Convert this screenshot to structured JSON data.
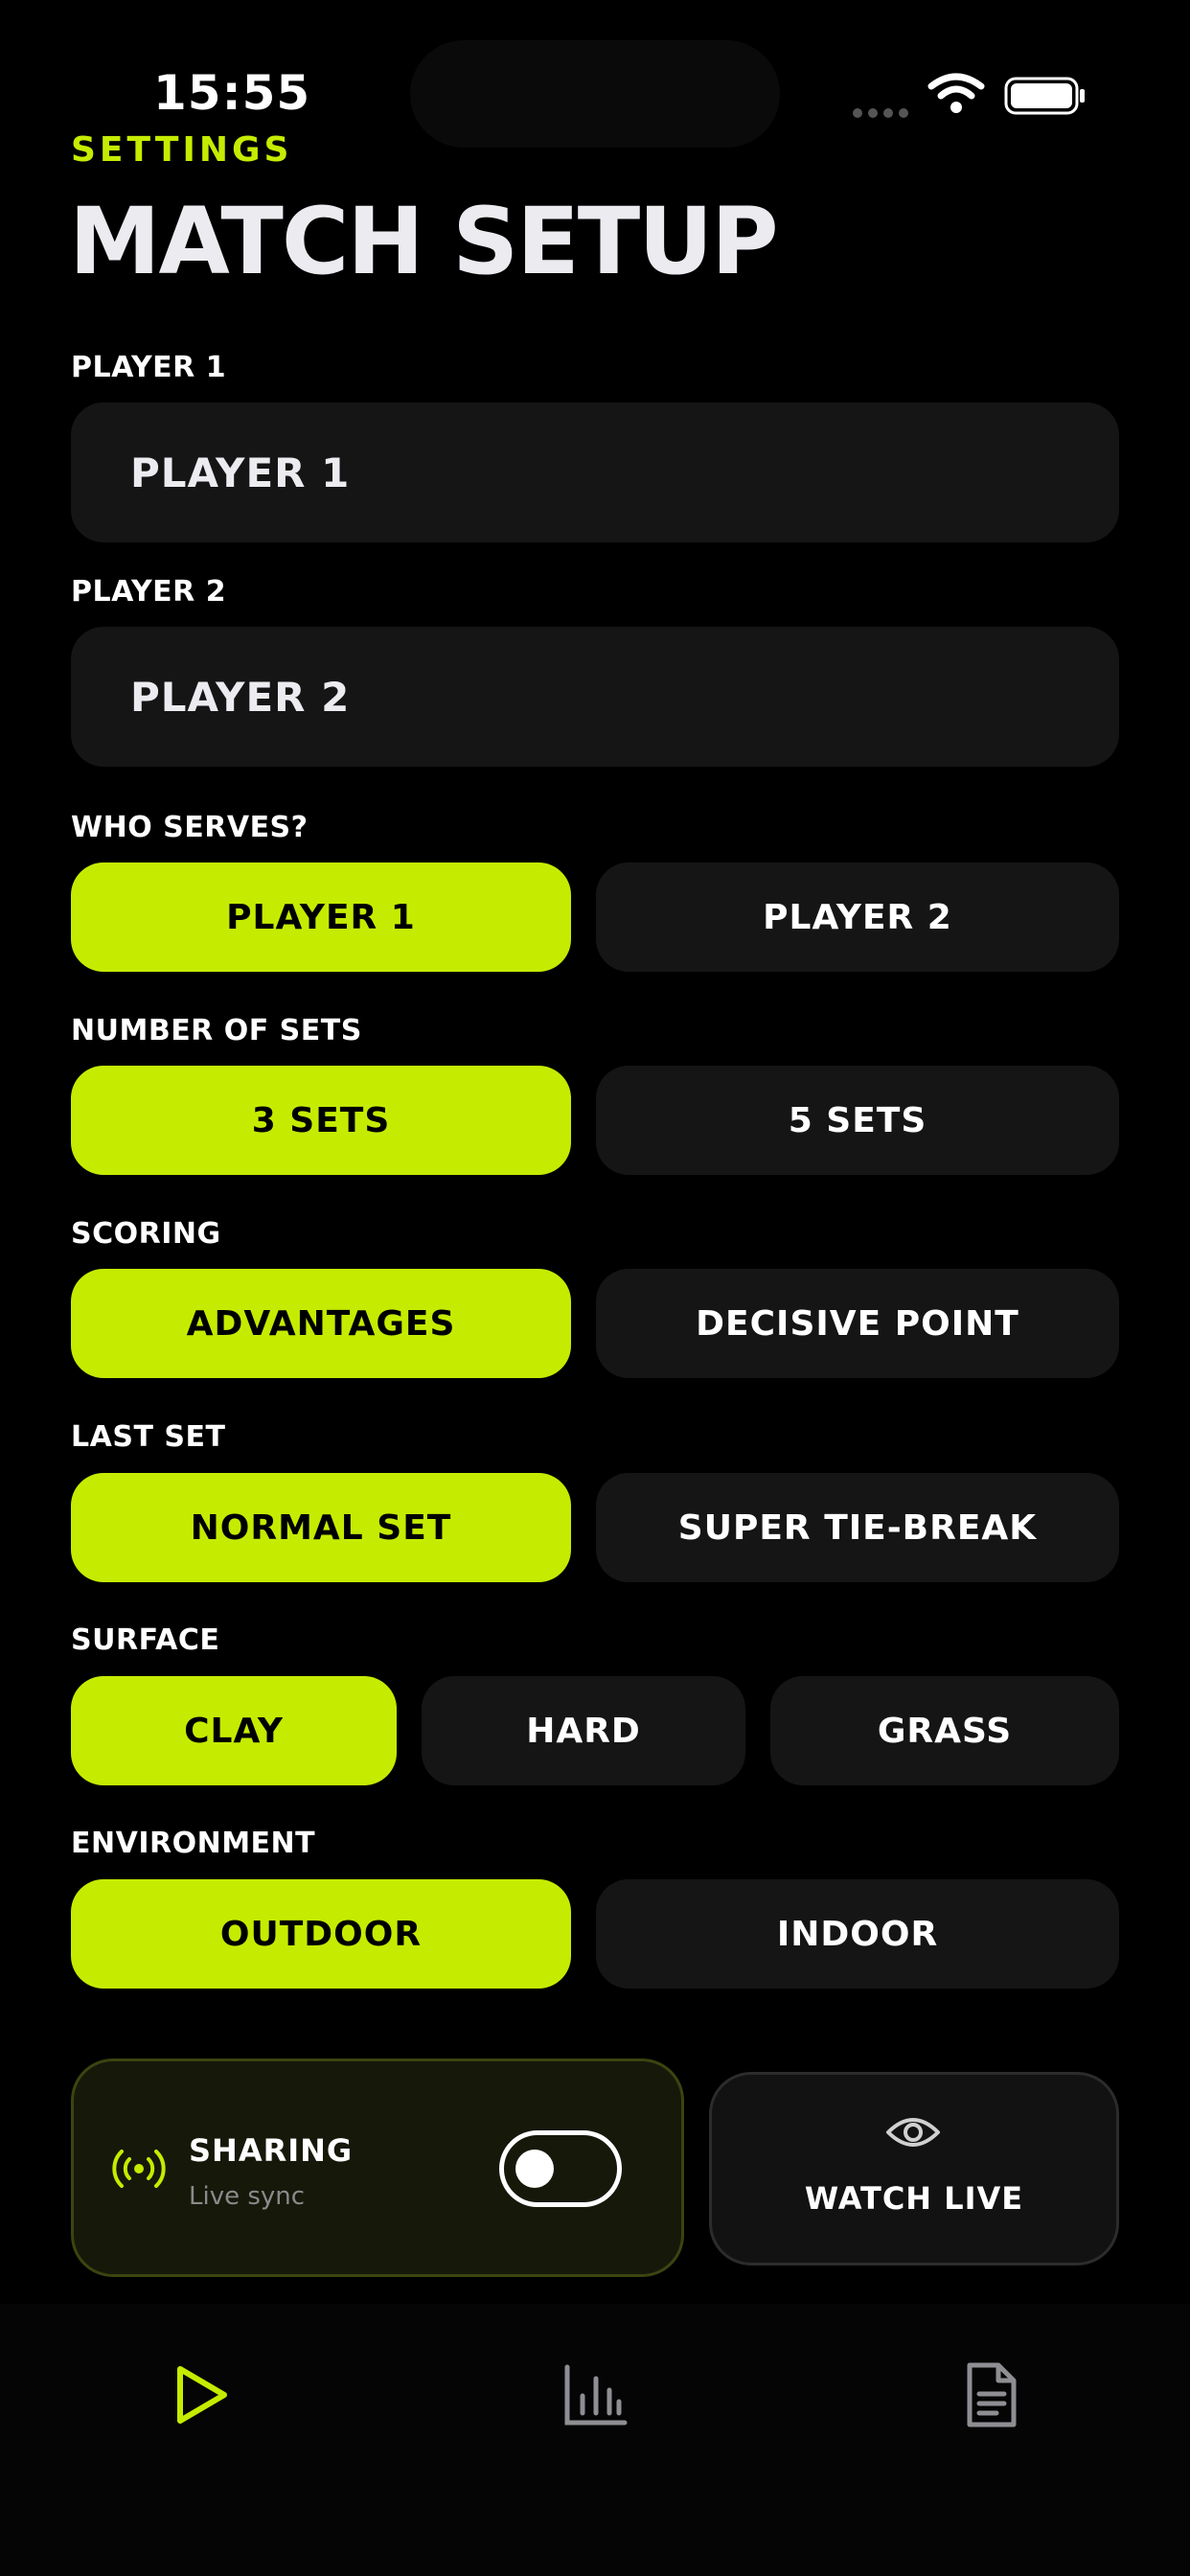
{
  "status_bar": {
    "time": "15:55"
  },
  "header": {
    "eyebrow": "SETTINGS",
    "title": "MATCH SETUP"
  },
  "player1": {
    "label": "PLAYER 1",
    "value": "PLAYER 1"
  },
  "player2": {
    "label": "PLAYER 2",
    "value": "PLAYER 2"
  },
  "serves": {
    "label": "WHO SERVES?",
    "options": [
      "PLAYER 1",
      "PLAYER 2"
    ],
    "selected": "PLAYER 1"
  },
  "sets": {
    "label": "NUMBER OF SETS",
    "options": [
      "3 SETS",
      "5 SETS"
    ],
    "selected": "3 SETS"
  },
  "scoring": {
    "label": "SCORING",
    "options": [
      "ADVANTAGES",
      "DECISIVE POINT"
    ],
    "selected": "ADVANTAGES"
  },
  "last_set": {
    "label": "LAST SET",
    "options": [
      "NORMAL SET",
      "SUPER TIE-BREAK"
    ],
    "selected": "NORMAL SET"
  },
  "surface": {
    "label": "SURFACE",
    "options": [
      "CLAY",
      "HARD",
      "GRASS"
    ],
    "selected": "CLAY"
  },
  "environment": {
    "label": "ENVIRONMENT",
    "options": [
      "OUTDOOR",
      "INDOOR"
    ],
    "selected": "OUTDOOR"
  },
  "sharing": {
    "title": "SHARING",
    "subtitle": "Live sync",
    "enabled": false,
    "icon": "broadcast-icon"
  },
  "watch_live": {
    "label": "WATCH LIVE",
    "icon": "eye-icon"
  },
  "tabs": [
    {
      "icon": "play-icon",
      "active": true
    },
    {
      "icon": "bar-chart-icon",
      "active": false
    },
    {
      "icon": "document-icon",
      "active": false
    }
  ],
  "colors": {
    "accent": "#c5ec00",
    "background": "#000000",
    "surface": "#151515",
    "inactive_icon": "#8e8e93"
  }
}
